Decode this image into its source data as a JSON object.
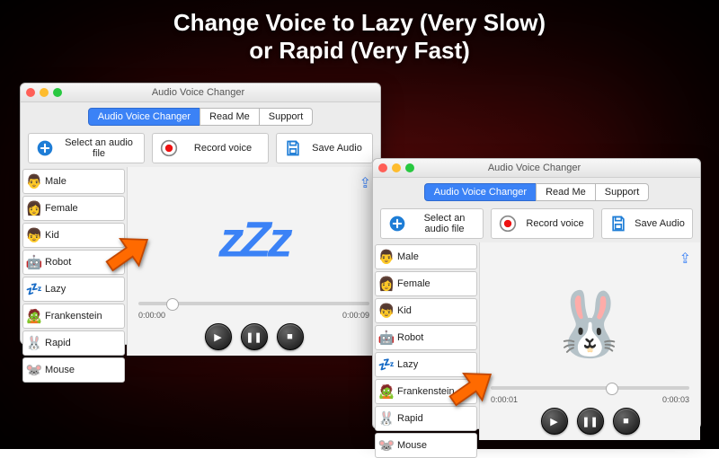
{
  "headline": {
    "line1": "Change Voice to Lazy (Very Slow)",
    "line2": "or Rapid (Very Fast)"
  },
  "windows": [
    {
      "title": "Audio Voice Changer",
      "tabs": [
        "Audio Voice Changer",
        "Read Me",
        "Support"
      ],
      "active_tab": 0,
      "toolbar": {
        "select": "Select an audio file",
        "record": "Record voice",
        "save": "Save Audio"
      },
      "voices": [
        {
          "icon": "👨",
          "label": "Male"
        },
        {
          "icon": "👩",
          "label": "Female"
        },
        {
          "icon": "👦",
          "label": "Kid"
        },
        {
          "icon": "🤖",
          "label": "Robot"
        },
        {
          "icon": "💤",
          "label": "Lazy"
        },
        {
          "icon": "🧟",
          "label": "Frankenstein"
        },
        {
          "icon": "🐰",
          "label": "Rapid"
        },
        {
          "icon": "🐭",
          "label": "Mouse"
        }
      ],
      "selected": "Lazy",
      "art": "zZz",
      "time": {
        "cur": "0:00:00",
        "dur": "0:00:09"
      },
      "knob_pct": 12
    },
    {
      "title": "Audio Voice Changer",
      "tabs": [
        "Audio Voice Changer",
        "Read Me",
        "Support"
      ],
      "active_tab": 0,
      "toolbar": {
        "select": "Select an audio file",
        "record": "Record voice",
        "save": "Save Audio"
      },
      "voices": [
        {
          "icon": "👨",
          "label": "Male"
        },
        {
          "icon": "👩",
          "label": "Female"
        },
        {
          "icon": "👦",
          "label": "Kid"
        },
        {
          "icon": "🤖",
          "label": "Robot"
        },
        {
          "icon": "💤",
          "label": "Lazy"
        },
        {
          "icon": "🧟",
          "label": "Frankenstein"
        },
        {
          "icon": "🐰",
          "label": "Rapid"
        },
        {
          "icon": "🐭",
          "label": "Mouse"
        }
      ],
      "selected": "Rapid",
      "art": "🐰",
      "time": {
        "cur": "0:00:01",
        "dur": "0:00:03"
      },
      "knob_pct": 58
    }
  ]
}
